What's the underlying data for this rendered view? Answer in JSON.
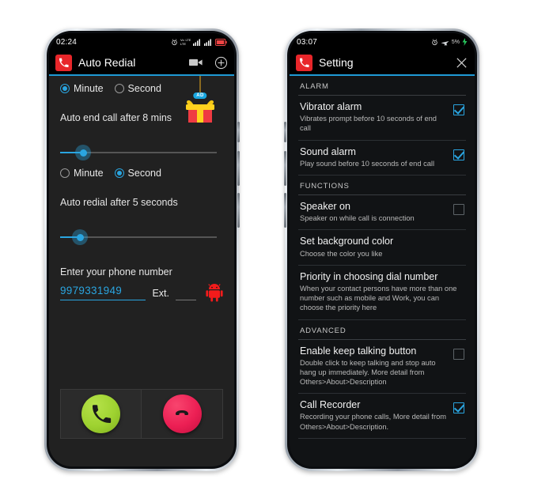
{
  "phone_left": {
    "status": {
      "time": "02:24",
      "icons": [
        "alarm-icon",
        "volte-icon",
        "signal-bar-icon",
        "signal-bar-icon",
        "battery-icon"
      ]
    },
    "appbar": {
      "title": "Auto Redial",
      "app_icon": "phone-app-icon",
      "video_icon": "video-camera-icon",
      "add_icon": "plus-circle-icon"
    },
    "unit_group_1": {
      "options": [
        {
          "label": "Minute",
          "selected": true
        },
        {
          "label": "Second",
          "selected": false
        }
      ]
    },
    "end_call_text": "Auto end call after 8 mins",
    "slider_1": {
      "value": 8,
      "percent": 10
    },
    "unit_group_2": {
      "options": [
        {
          "label": "Minute",
          "selected": false
        },
        {
          "label": "Second",
          "selected": true
        }
      ]
    },
    "redial_text": "Auto redial after 5 seconds",
    "slider_2": {
      "value": 5,
      "percent": 8
    },
    "phone_field": {
      "label": "Enter your phone number",
      "value": "9979331949",
      "ext_label": "Ext.",
      "ext_value": ""
    },
    "ad": {
      "badge": "AD",
      "icon": "gift-box-icon"
    },
    "android_icon": "android-robot-icon",
    "call_buttons": {
      "dial": "dial-call-icon",
      "hangup": "end-call-icon"
    }
  },
  "phone_right": {
    "status": {
      "time": "03:07",
      "icons": [
        "alarm-icon",
        "airplane-icon",
        "battery-percent-icon",
        "charging-icon"
      ],
      "battery_text": "5%"
    },
    "appbar": {
      "title": "Setting",
      "app_icon": "phone-app-icon",
      "close_icon": "close-icon"
    },
    "sections": [
      {
        "header": "ALARM",
        "items": [
          {
            "title": "Vibrator alarm",
            "subtitle": "Vibrates prompt before 10 seconds of end call",
            "checked": true
          },
          {
            "title": "Sound alarm",
            "subtitle": "Play sound before 10 seconds of end call",
            "checked": true
          }
        ]
      },
      {
        "header": "FUNCTIONS",
        "items": [
          {
            "title": "Speaker on",
            "subtitle": "Speaker on while call is connection",
            "checked": false
          },
          {
            "title": "Set background color",
            "subtitle": "Choose the color you like",
            "checked": null
          },
          {
            "title": "Priority in choosing dial number",
            "subtitle": "When your contact persons have more than one number such as mobile and Work, you can choose the priority here",
            "checked": null
          }
        ]
      },
      {
        "header": "ADVANCED",
        "items": [
          {
            "title": "Enable keep talking button",
            "subtitle": "Double click to keep talking and stop auto hang up immediately. More detail from Others>About>Description",
            "checked": false
          },
          {
            "title": "Call Recorder",
            "subtitle": "Recording your phone calls, More detail from Others>About>Description.",
            "checked": true
          }
        ]
      }
    ]
  },
  "colors": {
    "accent": "#2aa5e0",
    "app_red": "#e8262a",
    "dial_green": "#9ed230",
    "hang_red": "#ec1f54",
    "left_bg": "#212121",
    "right_bg": "#111315"
  }
}
